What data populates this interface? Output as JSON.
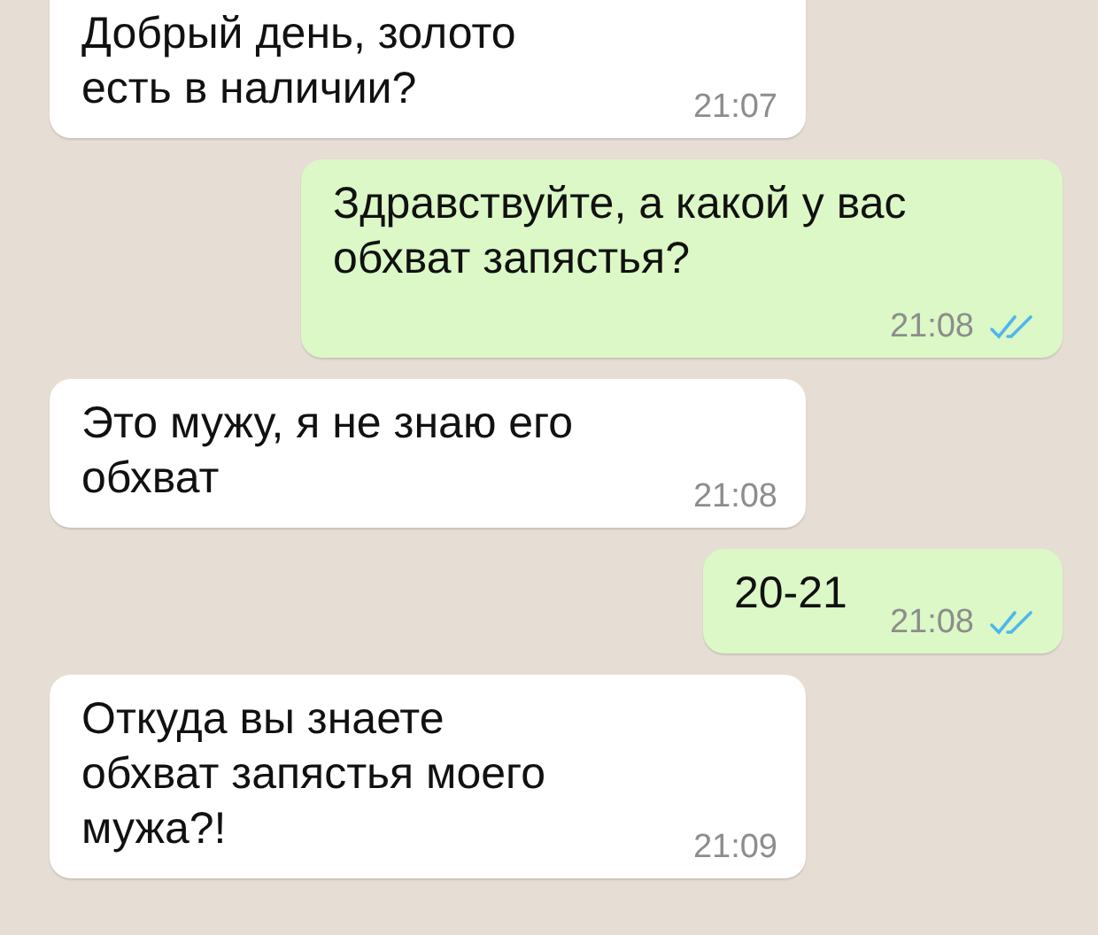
{
  "messages": [
    {
      "kind": "incoming",
      "text": "Добрый день, золото\nесть в наличии?",
      "time": "21:07"
    },
    {
      "kind": "outgoing",
      "text": "Здравствуйте, а какой у вас\nобхват запястья?",
      "time": "21:08",
      "read": true
    },
    {
      "kind": "incoming",
      "text": "Это мужу, я не знаю его\nобхват",
      "time": "21:08"
    },
    {
      "kind": "outgoing",
      "text": "20-21",
      "time": "21:08",
      "read": true
    },
    {
      "kind": "incoming",
      "text": "Откуда вы знаете\nобхват запястья моего\nмужа?!",
      "time": "21:09"
    }
  ]
}
